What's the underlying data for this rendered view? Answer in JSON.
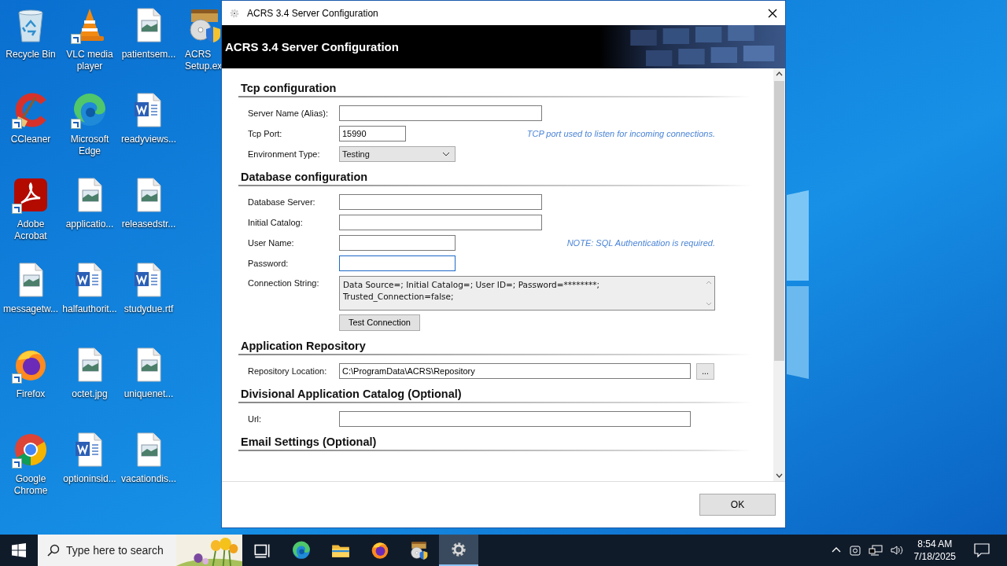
{
  "desktop_icons": [
    {
      "label": "Recycle Bin",
      "kind": "recycle",
      "shortcut": false
    },
    {
      "label": "CCleaner",
      "kind": "ccleaner",
      "shortcut": true
    },
    {
      "label": "Adobe Acrobat",
      "kind": "acrobat",
      "shortcut": true
    },
    {
      "label": "messagetw...",
      "kind": "image-file",
      "shortcut": false
    },
    {
      "label": "Firefox",
      "kind": "firefox",
      "shortcut": true
    },
    {
      "label": "Google Chrome",
      "kind": "chrome",
      "shortcut": true
    },
    {
      "label": "VLC media player",
      "kind": "vlc",
      "shortcut": true
    },
    {
      "label": "Microsoft Edge",
      "kind": "edge",
      "shortcut": true
    },
    {
      "label": "applicatio...",
      "kind": "image-file",
      "shortcut": false
    },
    {
      "label": "halfauthorit...",
      "kind": "word-file",
      "shortcut": false
    },
    {
      "label": "octet.jpg",
      "kind": "image-file",
      "shortcut": false
    },
    {
      "label": "optioninsid...",
      "kind": "word-file",
      "shortcut": false
    },
    {
      "label": "patientsem...",
      "kind": "image-file",
      "shortcut": false
    },
    {
      "label": "readyviews...",
      "kind": "word-file",
      "shortcut": false
    },
    {
      "label": "releasedstr...",
      "kind": "image-file",
      "shortcut": false
    },
    {
      "label": "studydue.rtf",
      "kind": "word-file",
      "shortcut": false
    },
    {
      "label": "uniquenet...",
      "kind": "image-file",
      "shortcut": false
    },
    {
      "label": "vacationdis...",
      "kind": "image-file",
      "shortcut": false
    },
    {
      "label": "ACRS Setup.ex",
      "kind": "installer",
      "shortcut": false
    }
  ],
  "window": {
    "title": "ACRS 3.4 Server Configuration",
    "banner_title": "ACRS 3.4 Server Configuration",
    "sections": [
      {
        "heading": "Tcp configuration",
        "fields": [
          {
            "label": "Server Name (Alias):",
            "kind": "field",
            "focused": false
          },
          {
            "label": "Tcp Port:",
            "kind": "port-field",
            "value": "15990",
            "focused": false,
            "hint": "TCP port used to listen for incoming connections."
          },
          {
            "label": "Environment Type:",
            "kind": "dropdown",
            "value": "Testing"
          }
        ]
      },
      {
        "heading": "Database configuration",
        "fields": [
          {
            "label": "Database Server:",
            "kind": "field",
            "focused": false
          },
          {
            "label": "Initial Catalog:",
            "kind": "field",
            "focused": false
          },
          {
            "label": "User Name:",
            "kind": "short-field",
            "focused": false,
            "hint": "NOTE: SQL Authentication is required."
          },
          {
            "label": "Password:",
            "kind": "short-field",
            "focused": true
          },
          {
            "label": "Connection String:",
            "kind": "memo",
            "lines": [
              "Data Source=; Initial Catalog=; User ID=; Password=********;",
              "Trusted_Connection=false;"
            ]
          },
          {
            "kind": "button",
            "label": "Test Connection"
          }
        ]
      },
      {
        "heading": "Application Repository",
        "fields": [
          {
            "label": "Repository Location:",
            "kind": "browse-field",
            "value": "C:\\ProgramData\\ACRS\\Repository",
            "focused": false,
            "button": "..."
          }
        ]
      },
      {
        "heading": "Divisional Application Catalog (Optional)",
        "fields": [
          {
            "label": "Url:",
            "kind": "long-field",
            "focused": false
          }
        ]
      },
      {
        "heading": "Email Settings (Optional)"
      }
    ],
    "ok_button": "OK"
  },
  "taskbar": {
    "search_placeholder": "Type here to search",
    "apps": [
      {
        "kind": "task-view",
        "selected": false
      },
      {
        "kind": "edge",
        "selected": false
      },
      {
        "kind": "folder",
        "selected": false
      },
      {
        "kind": "firefox",
        "selected": false
      },
      {
        "kind": "installer",
        "selected": false
      },
      {
        "kind": "gear",
        "selected": true
      }
    ],
    "time": "8:54 AM",
    "date": "7/18/2025"
  }
}
